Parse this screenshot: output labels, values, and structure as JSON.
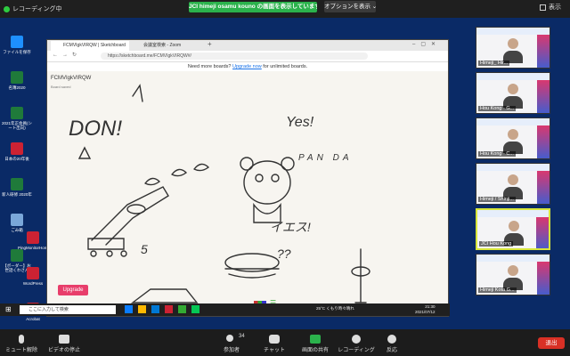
{
  "zoom": {
    "recording_label": "レコーディング中",
    "share_banner": "JCI himeji osamu kouno の画面を表示しています",
    "view_options": "オプションを表示",
    "display_label": "表示"
  },
  "desktop_icons": [
    {
      "label": "ファイルを保存",
      "color": "#1e90ff"
    },
    {
      "label": "名簿2020",
      "color": "#1f7a3a"
    },
    {
      "label": "2021年正会員(シート出向)",
      "color": "#1f7a3a"
    },
    {
      "label": "日本の20年後",
      "color": "#c23"
    },
    {
      "label": "新人研修 2020年",
      "color": "#1f7a3a"
    },
    {
      "label": "ごみ箱",
      "color": "#7aa7d9"
    },
    {
      "label": "【ボーダー】お世話くわさん",
      "color": "#1f7a3a"
    },
    {
      "label": "PingMonitorHome",
      "color": "#c23"
    },
    {
      "label": "WordPress",
      "color": "#c23"
    },
    {
      "label": "Acrobat",
      "color": "#c23"
    }
  ],
  "browser": {
    "tabs": [
      "FCMVIgkVIRQW | Sketchboard",
      "会議室検索 - Zoom"
    ],
    "url": "https://sketchboard.me/FCMVIgkVIRQW#/",
    "promo_prefix": "Need more boards?",
    "promo_link": "Upgrade now",
    "promo_suffix": "for unlimited boards.",
    "board_title": "FCMVIgkVIRQW",
    "board_meta": "Board saved",
    "upgrade_label": "Upgrade"
  },
  "drawing_text": {
    "don": "DON!",
    "yes": "Yes!",
    "panda": "PAN DA",
    "ikezu": "イエス!",
    "five": "5",
    "qq": "??"
  },
  "taskbar": {
    "search_placeholder": "ここに入力して検索",
    "weather": "25°C くもり時々晴れ",
    "time": "21:30",
    "date": "2021/07/12"
  },
  "participants": [
    {
      "name": "Himeji_ Hir..."
    },
    {
      "name": "Hou Kong - G..."
    },
    {
      "name": "Hou Kong - C..."
    },
    {
      "name": "Himeji / Shinji..."
    },
    {
      "name": "JCI Hou Kong"
    },
    {
      "name": "Himeji Kota G..."
    }
  ],
  "controls": {
    "mute": "ミュート解除",
    "video": "ビデオの停止",
    "participants": "参加者",
    "participants_count": "34",
    "chat": "チャット",
    "share": "画面の共有",
    "record": "レコーディング",
    "react": "反応",
    "leave": "退出"
  },
  "colors": {
    "zoom_green": "#2bb24c",
    "leave_red": "#d93025",
    "upgrade_pink": "#e83e6b",
    "active_border": "#d8e63a"
  }
}
